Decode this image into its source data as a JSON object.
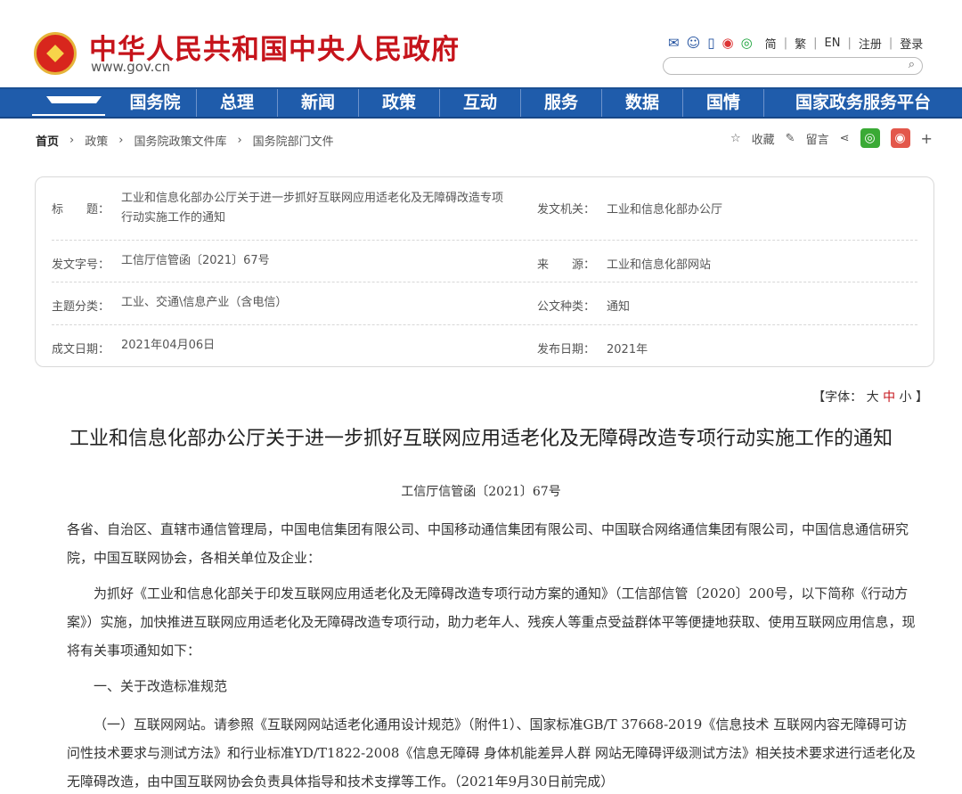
{
  "header": {
    "site_title": "中华人民共和国中央人民政府",
    "site_url": "www.gov.cn",
    "tools": [
      "✉",
      "☺",
      "▯",
      "◉",
      "◎"
    ],
    "lang": [
      "简",
      "繁",
      "EN",
      "注册",
      "登录"
    ],
    "search_placeholder": ""
  },
  "nav": {
    "items": [
      "国务院",
      "总理",
      "新闻",
      "政策",
      "互动",
      "服务",
      "数据",
      "国情",
      "国家政务服务平台"
    ]
  },
  "breadcrumb": [
    "首页",
    "政策",
    "国务院政策文件库",
    "国务院部门文件"
  ],
  "share": {
    "collect": "收藏",
    "comment": "留言"
  },
  "meta": {
    "title_label": "标　　题：",
    "title_value": "工业和信息化部办公厅关于进一步抓好互联网应用适老化及无障碍改造专项行动实施工作的通知",
    "issuer_label": "发文机关：",
    "issuer_value": "工业和信息化部办公厅",
    "docno_label": "发文字号：",
    "docno_value": "工信厅信管函〔2021〕67号",
    "source_label": "来　　源：",
    "source_value": "工业和信息化部网站",
    "category_label": "主题分类：",
    "category_value": "工业、交通\\信息产业（含电信）",
    "type_label": "公文种类：",
    "type_value": "通知",
    "date_label": "成文日期：",
    "date_value": "2021年04月06日",
    "publish_label": "发布日期：",
    "publish_value": "2021年"
  },
  "font_size": {
    "prefix": "【字体：",
    "large": "大",
    "medium": "中",
    "small": "小",
    "suffix": "】"
  },
  "document": {
    "title": "工业和信息化部办公厅关于进一步抓好互联网应用适老化及无障碍改造专项行动实施工作的通知",
    "number": "工信厅信管函〔2021〕67号",
    "p1": "各省、自治区、直辖市通信管理局，中国电信集团有限公司、中国移动通信集团有限公司、中国联合网络通信集团有限公司，中国信息通信研究院，中国互联网协会，各相关单位及企业：",
    "p2": "为抓好《工业和信息化部关于印发互联网应用适老化及无障碍改造专项行动方案的通知》（工信部信管〔2020〕200号，以下简称《行动方案》）实施，加快推进互联网应用适老化及无障碍改造专项行动，助力老年人、残疾人等重点受益群体平等便捷地获取、使用互联网应用信息，现将有关事项通知如下：",
    "h1": "一、关于改造标准规范",
    "p3": "（一）互联网网站。请参照《互联网网站适老化通用设计规范》（附件1）、国家标准GB/T 37668-2019《信息技术 互联网内容无障碍可访问性技术要求与测试方法》和行业标准YD/T1822-2008《信息无障碍 身体机能差异人群 网站无障碍评级测试方法》相关技术要求进行适老化及无障碍改造，由中国互联网协会负责具体指导和技术支撑等工作。（2021年9月30日前完成）"
  }
}
